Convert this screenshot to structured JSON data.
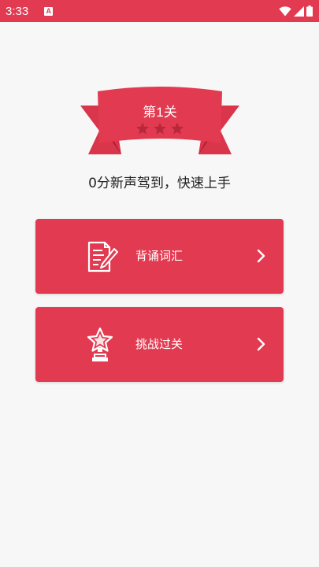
{
  "status_bar": {
    "time": "3:33",
    "notification_badge": "A",
    "icons": [
      "wifi-icon",
      "signal-icon",
      "battery-icon"
    ]
  },
  "level": {
    "title": "第1关",
    "stars_total": 3,
    "stars_earned": 0
  },
  "slogan": "0分新声驾到，快速上手",
  "cards": [
    {
      "label": "背诵词汇",
      "icon": "notebook-pen-icon"
    },
    {
      "label": "挑战过关",
      "icon": "star-trophy-icon"
    }
  ],
  "colors": {
    "accent": "#e23a50",
    "ribbon_dark": "#c42a3f",
    "star_empty": "#b8283c",
    "background": "#f7f7f8"
  }
}
